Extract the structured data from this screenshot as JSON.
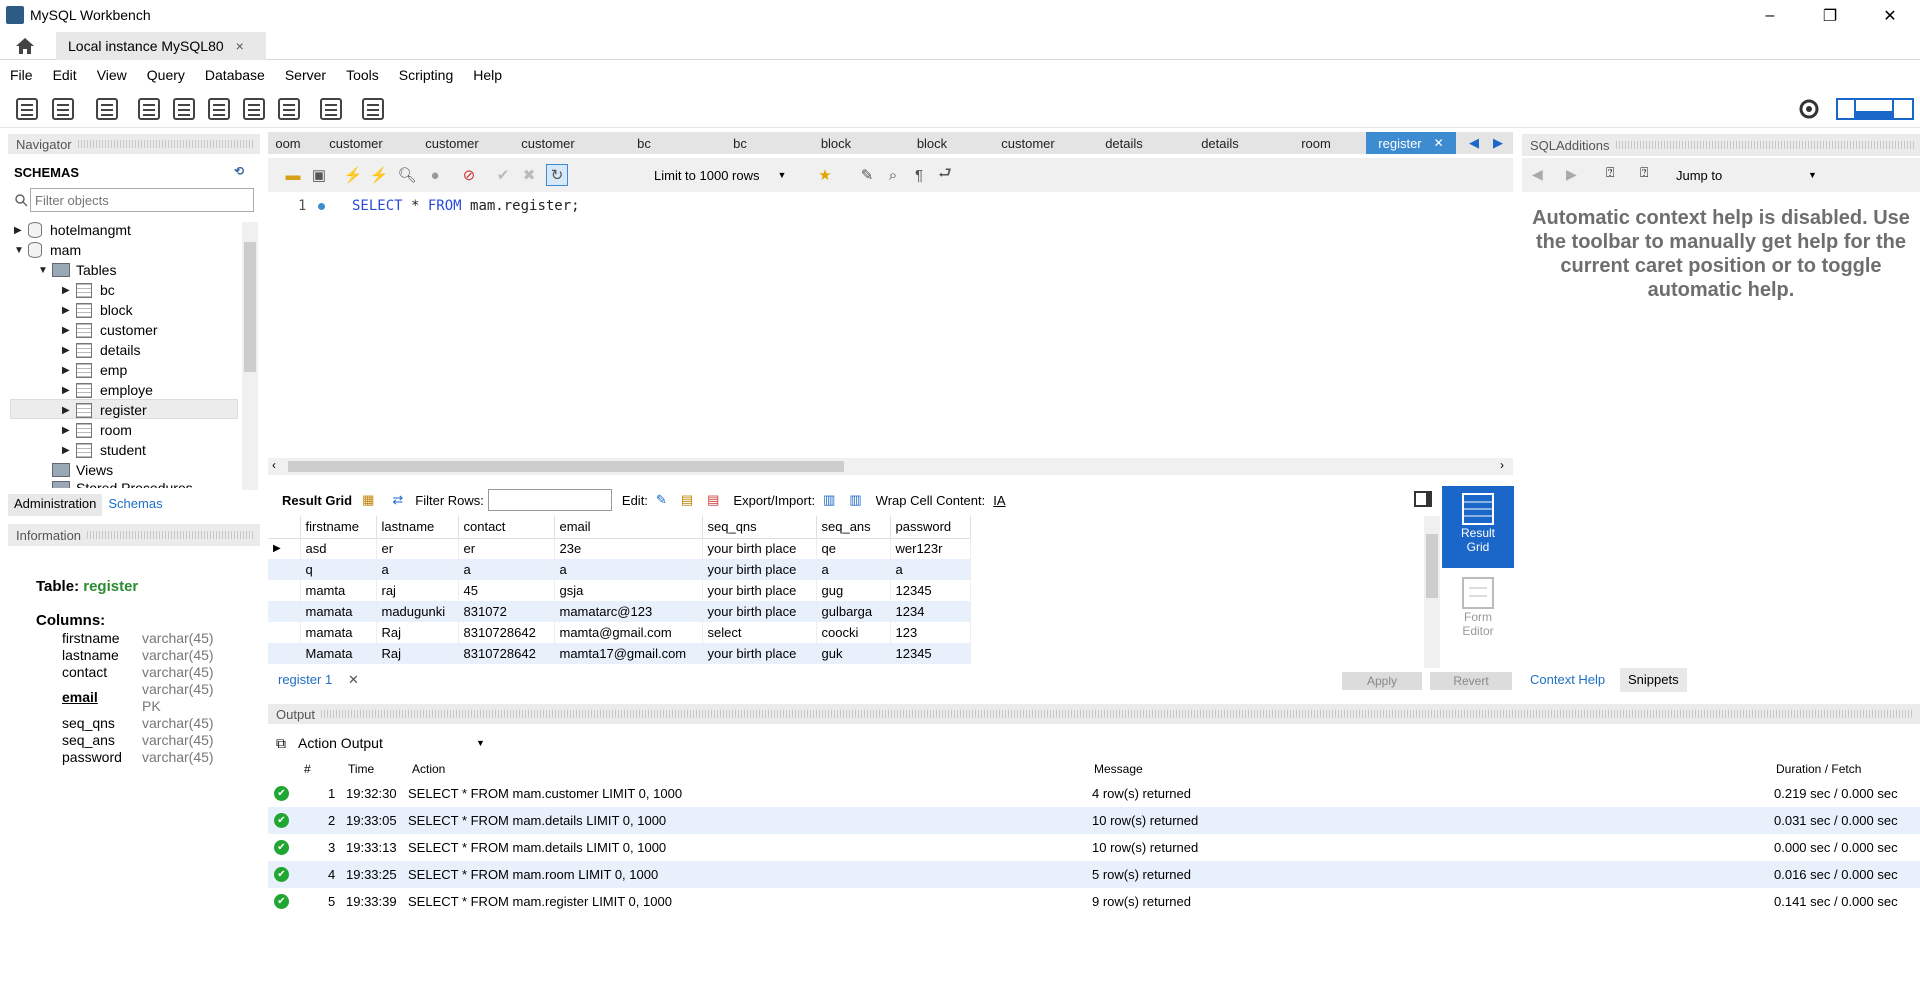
{
  "window": {
    "title": "MySQL Workbench",
    "minimize": "–",
    "restore": "❐",
    "close": "✕"
  },
  "connection_tab": {
    "label": "Local instance MySQL80",
    "close": "×"
  },
  "menu": [
    "File",
    "Edit",
    "View",
    "Query",
    "Database",
    "Server",
    "Tools",
    "Scripting",
    "Help"
  ],
  "navigator": {
    "header": "Navigator",
    "schemas_title": "SCHEMAS",
    "filter_placeholder": "Filter objects",
    "schemas": [
      "hotelmangmt",
      "mam"
    ],
    "tables_label": "Tables",
    "tables": [
      "bc",
      "block",
      "customer",
      "details",
      "emp",
      "employe",
      "register",
      "room",
      "student"
    ],
    "views_label": "Views",
    "stored_label": "Stored Procedures",
    "tab_admin": "Administration",
    "tab_schemas": "Schemas"
  },
  "information": {
    "header": "Information",
    "table_label": "Table:",
    "table_name": "register",
    "columns_label": "Columns:",
    "columns": [
      {
        "name": "firstname",
        "type": "varchar(45)"
      },
      {
        "name": "lastname",
        "type": "varchar(45)"
      },
      {
        "name": "contact",
        "type": "varchar(45)"
      },
      {
        "name": "email",
        "type": "varchar(45)",
        "extra": "PK"
      },
      {
        "name": "seq_qns",
        "type": "varchar(45)"
      },
      {
        "name": "seq_ans",
        "type": "varchar(45)"
      },
      {
        "name": "password",
        "type": "varchar(45)"
      }
    ]
  },
  "editor_tabs": [
    "oom",
    "customer",
    "customer",
    "customer",
    "bc",
    "bc",
    "block",
    "block",
    "customer",
    "details",
    "details",
    "room",
    "register"
  ],
  "editor": {
    "limit": "Limit to 1000 rows",
    "line_number": "1",
    "sql_kw1": "SELECT",
    "sql_mid": " * ",
    "sql_kw2": "FROM",
    "sql_rest": " mam.register;"
  },
  "result_toolbar": {
    "result_grid": "Result Grid",
    "filter_rows": "Filter Rows:",
    "edit": "Edit:",
    "export": "Export/Import:",
    "wrap": "Wrap Cell Content:"
  },
  "result": {
    "columns": [
      "firstname",
      "lastname",
      "contact",
      "email",
      "seq_qns",
      "seq_ans",
      "password"
    ],
    "rows": [
      [
        "asd",
        "er",
        "er",
        "23e",
        "your birth place",
        "qe",
        "wer123r"
      ],
      [
        "q",
        "a",
        "a",
        "a",
        "your birth place",
        "a",
        "a"
      ],
      [
        "mamta",
        "raj",
        "45",
        "gsja",
        "your birth place",
        "gug",
        "12345"
      ],
      [
        "mamata",
        "madugunki",
        "831072",
        "mamatarc@123",
        "your birth place",
        "gulbarga",
        "1234"
      ],
      [
        "mamata",
        "Raj",
        "8310728642",
        "mamta@gmail.com",
        "select",
        "coocki",
        "123"
      ],
      [
        "Mamata",
        "Raj",
        "8310728642",
        "mamta17@gmail.com",
        "your birth place",
        "guk",
        "12345"
      ]
    ],
    "tab_label": "register 1",
    "apply": "Apply",
    "revert": "Revert"
  },
  "side_buttons": {
    "result_grid_1": "Result",
    "result_grid_2": "Grid",
    "form_editor_1": "Form",
    "form_editor_2": "Editor"
  },
  "sql_additions": {
    "header": "SQLAdditions",
    "jump_to": "Jump to",
    "help_text": "Automatic context help is disabled. Use the toolbar to manually get help for the current caret position or to toggle automatic help.",
    "tab_context": "Context Help",
    "tab_snippets": "Snippets"
  },
  "output": {
    "header": "Output",
    "selector": "Action Output",
    "columns": [
      "#",
      "Time",
      "Action",
      "Message",
      "Duration / Fetch"
    ],
    "rows": [
      {
        "n": "1",
        "time": "19:32:30",
        "action": "SELECT * FROM mam.customer LIMIT 0, 1000",
        "message": "4 row(s) returned",
        "duration": "0.219 sec / 0.000 sec"
      },
      {
        "n": "2",
        "time": "19:33:05",
        "action": "SELECT * FROM mam.details LIMIT 0, 1000",
        "message": "10 row(s) returned",
        "duration": "0.031 sec / 0.000 sec"
      },
      {
        "n": "3",
        "time": "19:33:13",
        "action": "SELECT * FROM mam.details LIMIT 0, 1000",
        "message": "10 row(s) returned",
        "duration": "0.000 sec / 0.000 sec"
      },
      {
        "n": "4",
        "time": "19:33:25",
        "action": "SELECT * FROM mam.room LIMIT 0, 1000",
        "message": "5 row(s) returned",
        "duration": "0.016 sec / 0.000 sec"
      },
      {
        "n": "5",
        "time": "19:33:39",
        "action": "SELECT * FROM mam.register LIMIT 0, 1000",
        "message": "9 row(s) returned",
        "duration": "0.141 sec / 0.000 sec"
      }
    ]
  }
}
